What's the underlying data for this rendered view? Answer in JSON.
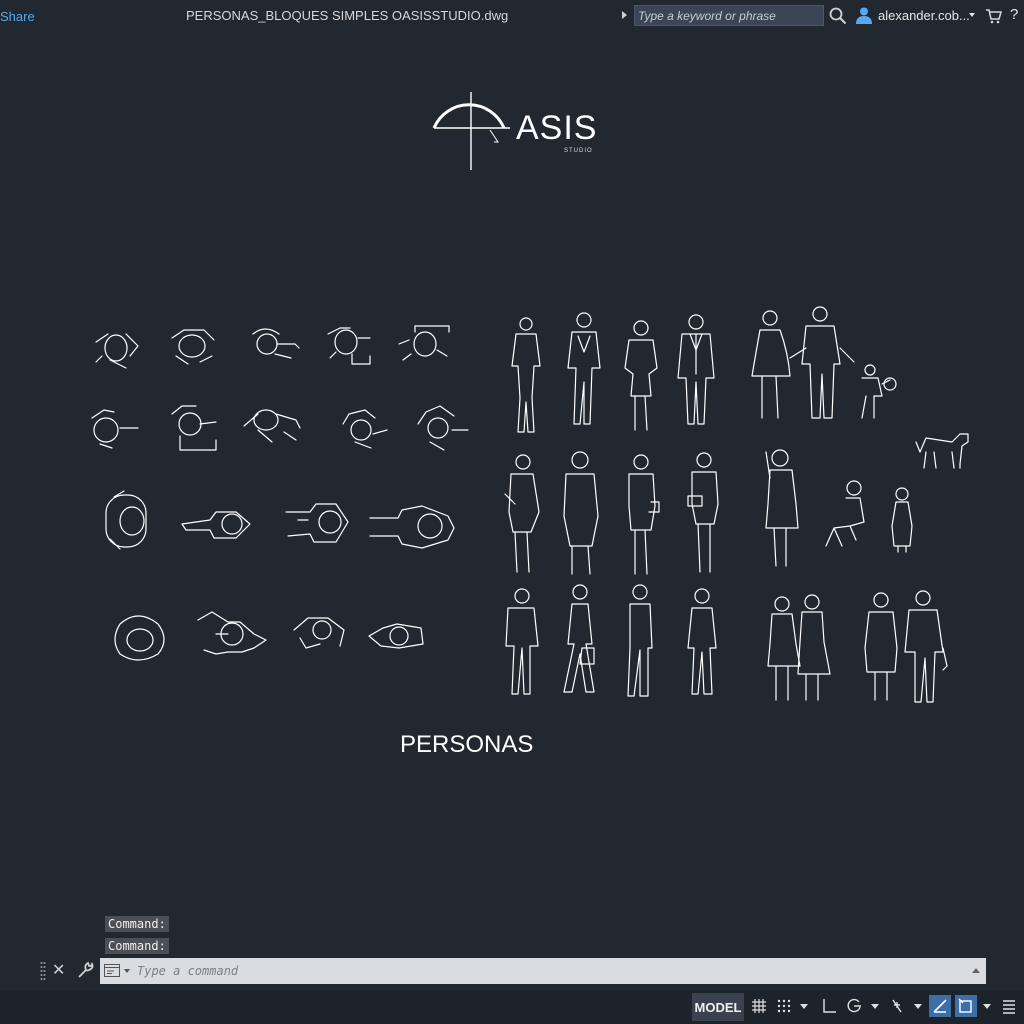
{
  "titlebar": {
    "share_label": "Share",
    "document_title": "PERSONAS_BLOQUES SIMPLES OASISSTUDIO.dwg",
    "search_placeholder": "Type a keyword or phrase",
    "user_name": "alexander.cob...",
    "icons": [
      "search-icon",
      "user-icon",
      "cart-icon"
    ]
  },
  "canvas": {
    "logo_text": "ASIS",
    "logo_subtext": "STUDIO",
    "section_label": "PERSONAS",
    "background": "#212830",
    "line_color": "#ffffff"
  },
  "command_line": {
    "history": [
      "Command:",
      "Command:"
    ],
    "placeholder": "Type a command"
  },
  "statusbar": {
    "model_label": "MODEL",
    "active_color": "#3d6ea8",
    "icons": [
      "grid-icon",
      "snap-grid-icon",
      "ortho-icon",
      "polar-tracking-icon",
      "object-snap-icon",
      "isometric-draft-icon",
      "selection-cycling-icon",
      "customize-icon"
    ]
  }
}
